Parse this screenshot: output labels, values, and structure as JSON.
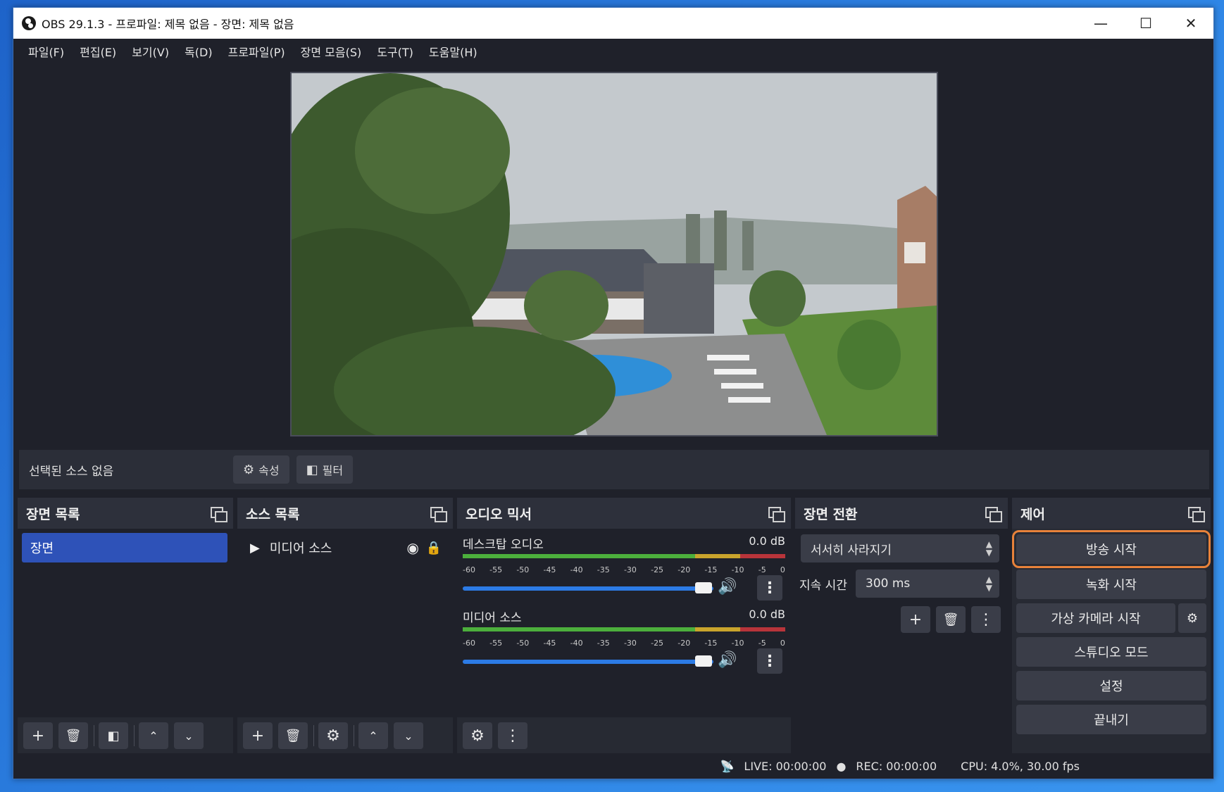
{
  "window": {
    "title": "OBS 29.1.3 - 프로파일: 제목 없음 - 장면: 제목 없음"
  },
  "menu": [
    "파일(F)",
    "편집(E)",
    "보기(V)",
    "독(D)",
    "프로파일(P)",
    "장면 모음(S)",
    "도구(T)",
    "도움말(H)"
  ],
  "context": {
    "no_source": "선택된 소스 없음",
    "properties": "속성",
    "filters": "필터"
  },
  "scenes": {
    "title": "장면 목록",
    "items": [
      "장면"
    ]
  },
  "sources": {
    "title": "소스 목록",
    "items": [
      "미디어 소스"
    ]
  },
  "mixer": {
    "title": "오디오 믹서",
    "channels": [
      {
        "name": "데스크탑 오디오",
        "db": "0.0 dB"
      },
      {
        "name": "미디어 소스",
        "db": "0.0 dB"
      }
    ],
    "ticks": [
      "-60",
      "-55",
      "-50",
      "-45",
      "-40",
      "-35",
      "-30",
      "-25",
      "-20",
      "-15",
      "-10",
      "-5",
      "0"
    ]
  },
  "transitions": {
    "title": "장면 전환",
    "selected": "서서히 사라지기",
    "duration_label": "지속 시간",
    "duration_value": "300 ms"
  },
  "controls": {
    "title": "제어",
    "start_stream": "방송 시작",
    "start_record": "녹화 시작",
    "start_virtualcam": "가상 카메라 시작",
    "studio_mode": "스튜디오 모드",
    "settings": "설정",
    "exit": "끝내기"
  },
  "status": {
    "live": "LIVE: 00:00:00",
    "rec": "REC: 00:00:00",
    "cpu": "CPU: 4.0%, 30.00 fps"
  },
  "colors": {
    "accent": "#2e52b8",
    "highlight": "#e8823a"
  }
}
